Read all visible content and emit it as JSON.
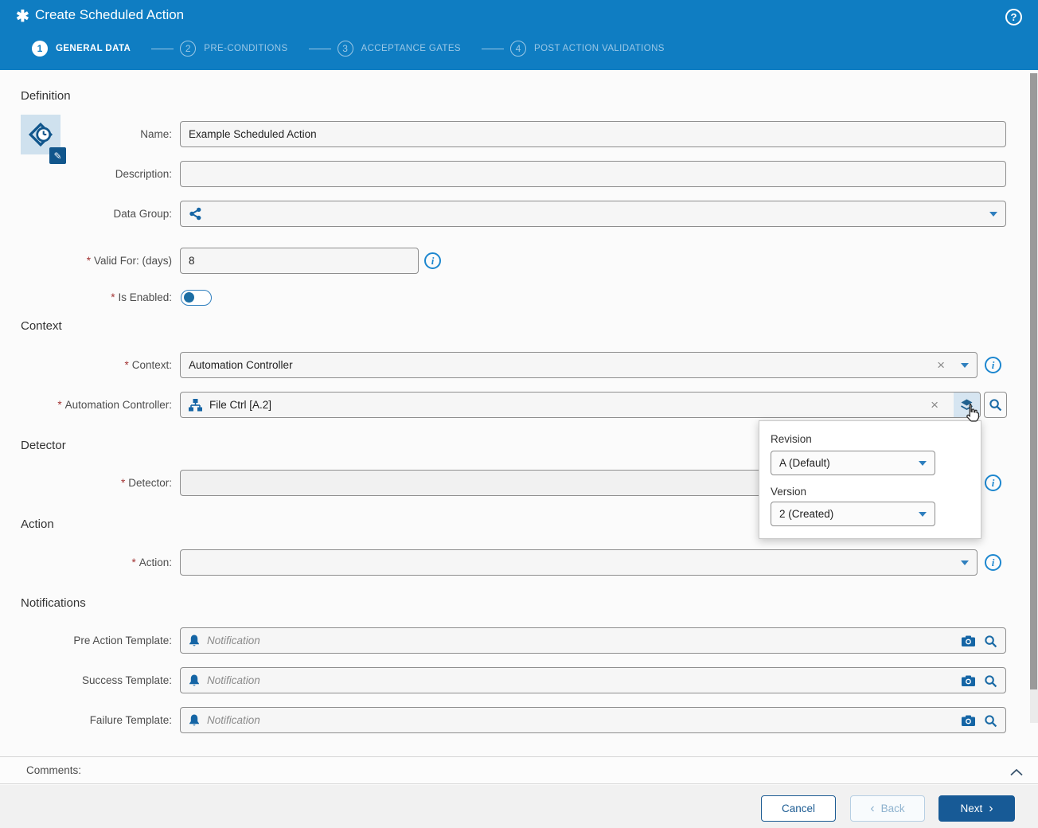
{
  "misc": {
    "required_marker": "*"
  },
  "icons": {
    "title_asterisk": "✱",
    "help_glyph": "?",
    "edit_pencil": "✎",
    "clear_x": "×"
  },
  "colors": {
    "header_bg": "#0f7dc2",
    "primary_dark": "#175a96",
    "accent": "#1d87cf"
  },
  "header": {
    "title": "Create Scheduled Action",
    "steps": [
      {
        "num": "1",
        "label": "GENERAL DATA"
      },
      {
        "num": "2",
        "label": "PRE-CONDITIONS"
      },
      {
        "num": "3",
        "label": "ACCEPTANCE GATES"
      },
      {
        "num": "4",
        "label": "POST ACTION VALIDATIONS"
      }
    ]
  },
  "definition": {
    "heading": "Definition",
    "name_label": "Name:",
    "name_value": "Example Scheduled Action",
    "description_label": "Description:",
    "description_value": "",
    "data_group_label": "Data Group:",
    "data_group_value": "",
    "valid_for_label": "Valid For: (days)",
    "valid_for_value": "8",
    "is_enabled_label": "Is Enabled:",
    "is_enabled_state": "off"
  },
  "context": {
    "heading": "Context",
    "context_label": "Context:",
    "context_value": "Automation Controller",
    "controller_label": "Automation Controller:",
    "controller_value": "File Ctrl [A.2]"
  },
  "detector": {
    "heading": "Detector",
    "label": "Detector:",
    "value": ""
  },
  "action": {
    "heading": "Action",
    "label": "Action:",
    "value": ""
  },
  "notifications": {
    "heading": "Notifications",
    "pre_label": "Pre Action Template:",
    "success_label": "Success Template:",
    "failure_label": "Failure Template:",
    "placeholder": "Notification"
  },
  "popup": {
    "revision_label": "Revision",
    "revision_value": "A (Default)",
    "version_label": "Version",
    "version_value": "2 (Created)"
  },
  "comments": {
    "label": "Comments:"
  },
  "footer": {
    "cancel": "Cancel",
    "back": "Back",
    "next": "Next",
    "back_chevron": "‹",
    "next_chevron": "›"
  }
}
